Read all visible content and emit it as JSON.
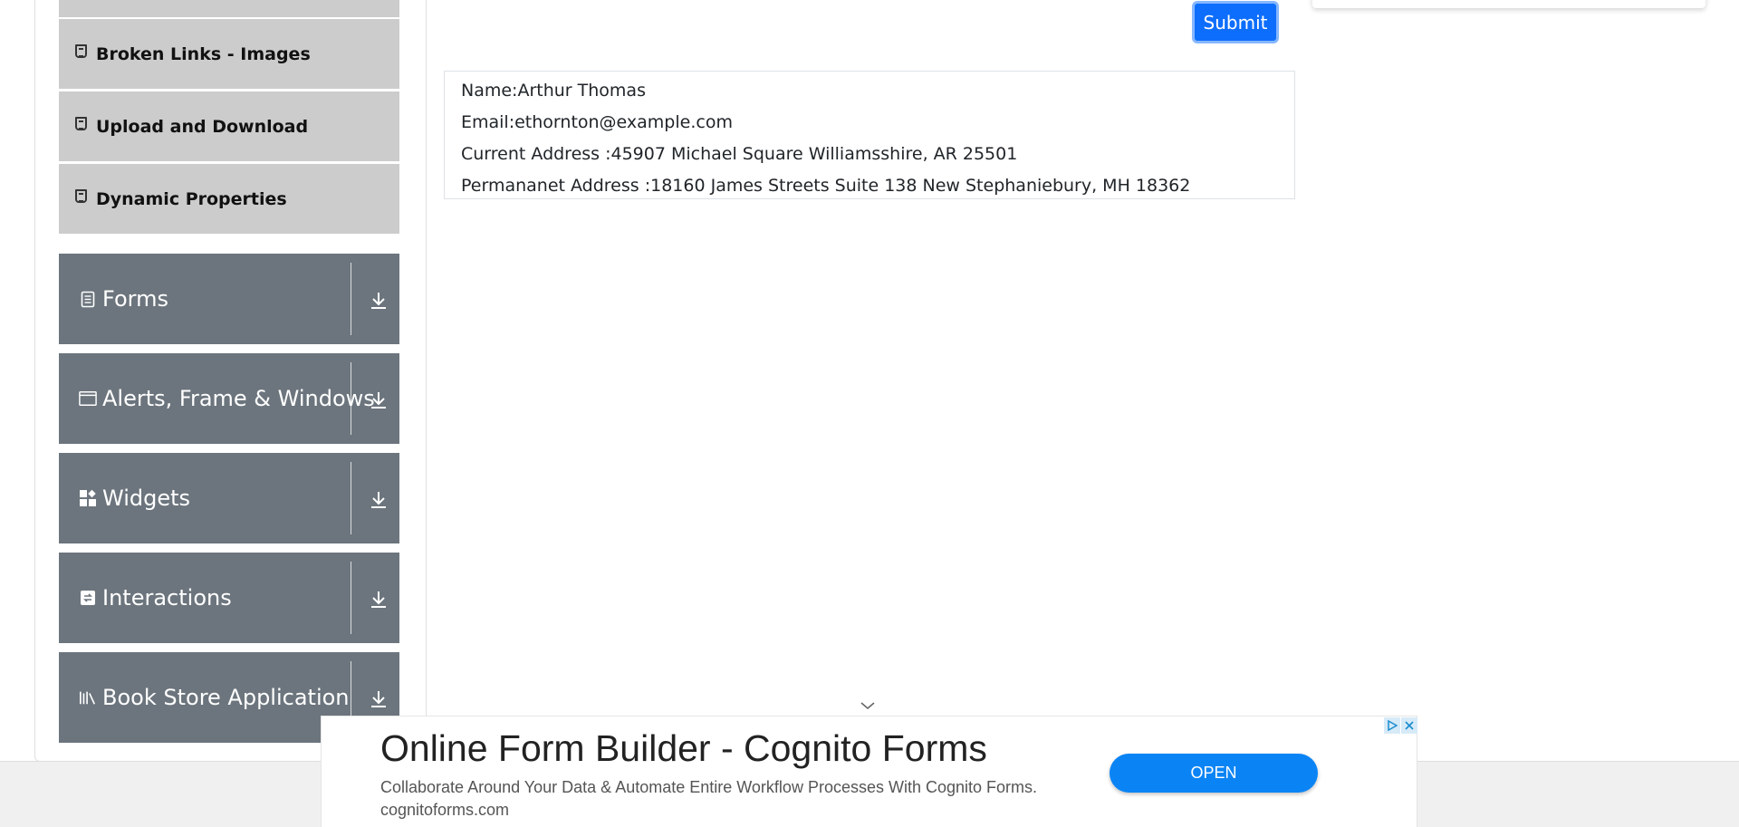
{
  "sidebar": {
    "sub_items": [
      {
        "label": "Broken Links - Images"
      },
      {
        "label": "Upload and Download"
      },
      {
        "label": "Dynamic Properties"
      }
    ],
    "groups": [
      {
        "label": "Forms",
        "icon": "form-icon"
      },
      {
        "label": "Alerts, Frame & Windows",
        "icon": "window-icon"
      },
      {
        "label": "Widgets",
        "icon": "widgets-icon"
      },
      {
        "label": "Interactions",
        "icon": "interactions-icon"
      },
      {
        "label": "Book Store Application",
        "icon": "books-icon"
      }
    ]
  },
  "form": {
    "submit_label": "Submit"
  },
  "output": {
    "name": "Name:Arthur Thomas",
    "email": "Email:ethornton@example.com",
    "current_address": "Current Address :45907 Michael Square Williamsshire, AR 25501",
    "permanent_address": "Permananet Address :18160 James Streets Suite 138 New Stephaniebury, MH 18362"
  },
  "ad": {
    "title": "Online Form Builder - Cognito Forms",
    "description": "Collaborate Around Your Data & Automate Entire Workflow Processes With Cognito Forms. cognitoforms.com",
    "open_label": "OPEN"
  },
  "colors": {
    "primary": "#0d6efd",
    "group_bg": "#6c757d",
    "sub_item_bg": "#cccccc",
    "ad_button": "#0a84f5"
  }
}
